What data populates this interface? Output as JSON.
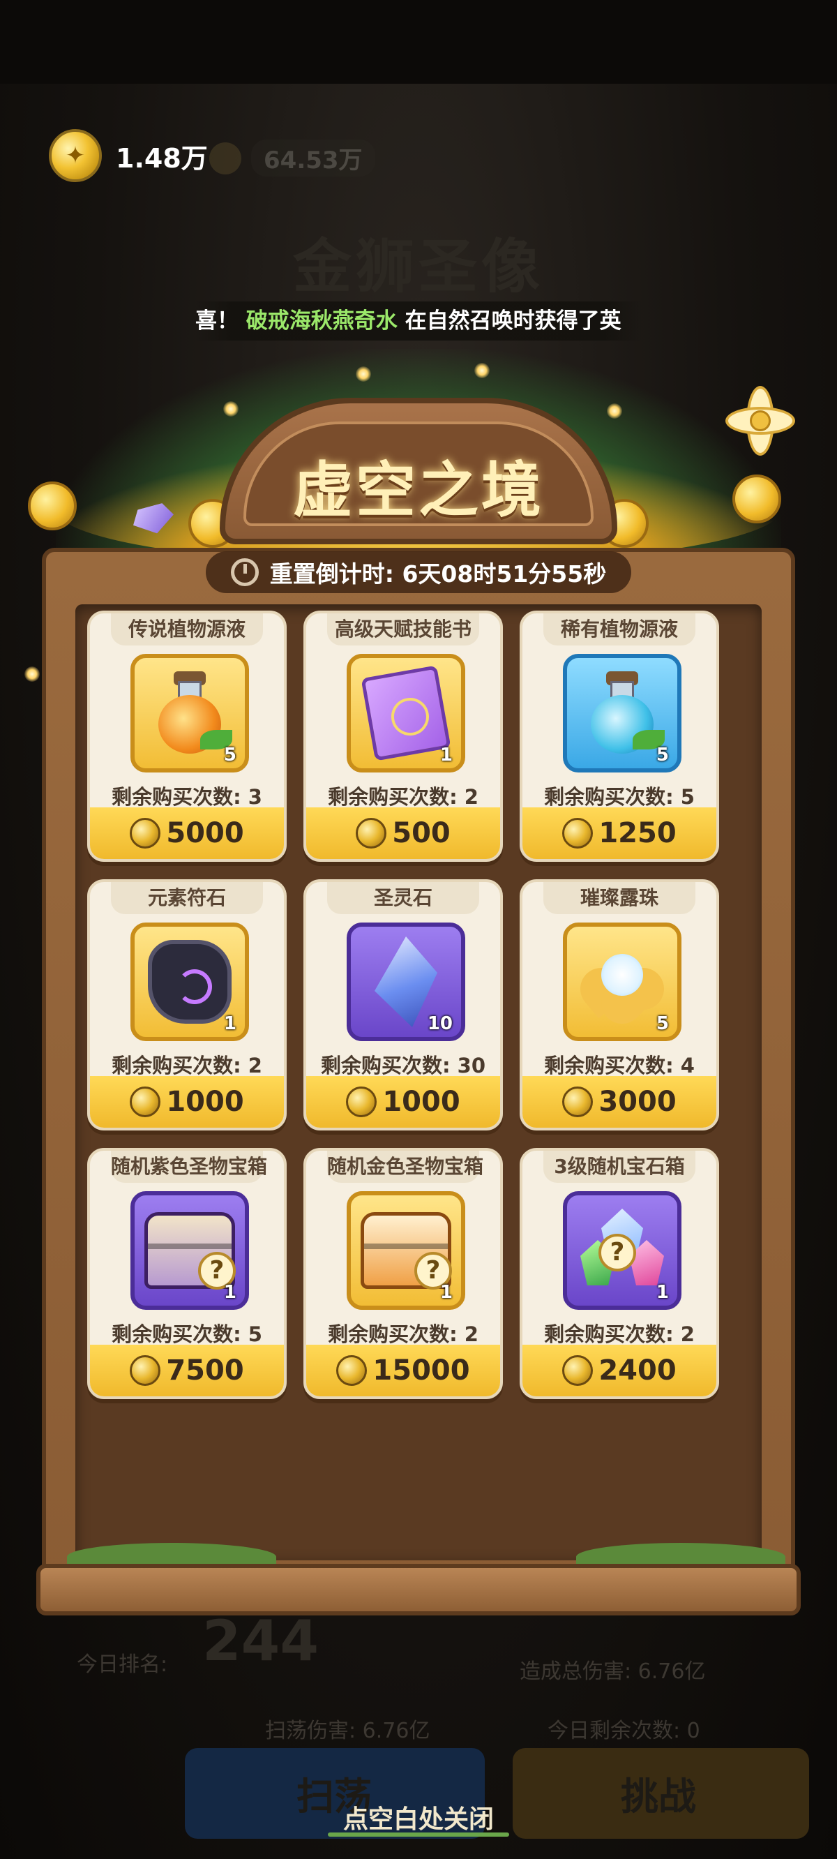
{
  "currency": {
    "amount": "1.48万",
    "secondary_amount": "64.53万"
  },
  "background": {
    "title": "金狮圣像",
    "rank_label": "今日排名:",
    "rank_value": "244",
    "total_damage_label": "造成总伤害: 6.76亿",
    "sweep_damage_label": "扫荡伤害: 6.76亿",
    "attempts_label": "今日剩余次数: 0",
    "sweep_button": "扫荡",
    "challenge_button": "挑战"
  },
  "marquee": {
    "prefix": "喜！",
    "highlight": "破戒海秋燕奇水",
    "suffix": "在自然召唤时获得了英"
  },
  "panel": {
    "title": "虚空之境",
    "timer": "重置倒计时: 6天08时51分55秒"
  },
  "shop": {
    "items": [
      {
        "name": "传说植物源液",
        "count": "5",
        "remain": "剩余购买次数: 3",
        "price": "5000",
        "icon": "orange-potion-icon",
        "frame": "gold"
      },
      {
        "name": "高级天赋技能书",
        "count": "1",
        "remain": "剩余购买次数: 2",
        "price": "500",
        "icon": "skill-book-icon",
        "frame": "gold"
      },
      {
        "name": "稀有植物源液",
        "count": "5",
        "remain": "剩余购买次数: 5",
        "price": "1250",
        "icon": "blue-potion-icon",
        "frame": "blue"
      },
      {
        "name": "元素符石",
        "count": "1",
        "remain": "剩余购买次数: 2",
        "price": "1000",
        "icon": "rune-stone-icon",
        "frame": "gold"
      },
      {
        "name": "圣灵石",
        "count": "10",
        "remain": "剩余购买次数: 30",
        "price": "1000",
        "icon": "crystal-icon",
        "frame": "purple"
      },
      {
        "name": "璀璨露珠",
        "count": "5",
        "remain": "剩余购买次数: 4",
        "price": "3000",
        "icon": "dew-flower-icon",
        "frame": "gold"
      },
      {
        "name": "随机紫色圣物宝箱",
        "count": "1",
        "remain": "剩余购买次数: 5",
        "price": "7500",
        "icon": "purple-chest-icon",
        "frame": "purple"
      },
      {
        "name": "随机金色圣物宝箱",
        "count": "1",
        "remain": "剩余购买次数: 2",
        "price": "15000",
        "icon": "gold-chest-icon",
        "frame": "gold"
      },
      {
        "name": "3级随机宝石箱",
        "count": "1",
        "remain": "剩余购买次数: 2",
        "price": "2400",
        "icon": "gem-box-icon",
        "frame": "purple"
      }
    ]
  },
  "hint": "点空白处关闭",
  "colors": {
    "price_bar": "#f0b92c",
    "card_bg": "#f6efe1",
    "title_text": "#fff0b8",
    "marquee_highlight": "#9be86a"
  }
}
